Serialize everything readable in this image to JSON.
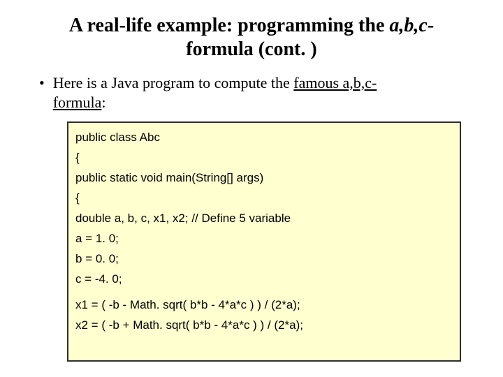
{
  "title": {
    "prefix": "A real-life example: programming the ",
    "ital": "a,b,c",
    "suffix1": "-",
    "line2": "formula (cont. )"
  },
  "bullet": {
    "dot": "•",
    "t1": "Here is a Java program to compute the ",
    "u1": "famous a,b,c-",
    "u2": "formula",
    "t2": ":"
  },
  "code": {
    "l1": "public class Abc",
    "l2": "{",
    "l3": "public static void main(String[] args)",
    "l4": "{",
    "l5": "double a, b, c, x1, x2; // Define 5 variable",
    "l6": "a = 1. 0;",
    "l7": "b = 0. 0;",
    "l8": "c = -4. 0;",
    "l9": "x1 = ( -b - Math. sqrt( b*b - 4*a*c ) ) / (2*a);",
    "l10": "x2 = ( -b + Math. sqrt( b*b - 4*a*c ) ) / (2*a);"
  }
}
